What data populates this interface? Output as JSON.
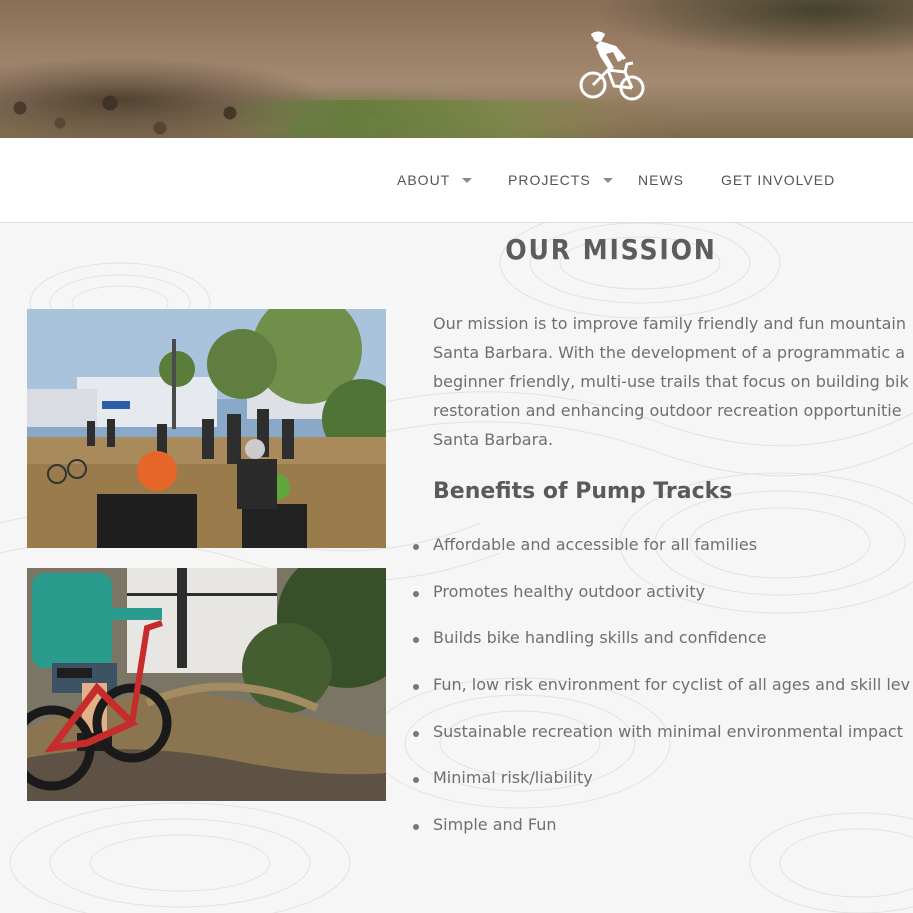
{
  "hero": {
    "logo_icon": "mountain-biker-icon"
  },
  "nav": {
    "items": [
      {
        "label": "ABOUT",
        "has_dropdown": true
      },
      {
        "label": "PROJECTS",
        "has_dropdown": true
      },
      {
        "label": "NEWS",
        "has_dropdown": false
      },
      {
        "label": "GET INVOLVED",
        "has_dropdown": false
      }
    ]
  },
  "mission": {
    "title": "OUR MISSION",
    "paragraph_lines": [
      "Our mission is to improve family friendly and fun mountain",
      "Santa Barbara.  With the development of a programmatic a",
      "beginner friendly, multi-use trails that focus on building bik",
      "restoration and enhancing outdoor recreation opportunitie",
      "Santa Barbara."
    ],
    "benefits_heading": "Benefits of Pump Tracks",
    "benefits": [
      "Affordable and accessible for all families",
      "Promotes healthy outdoor activity",
      "Builds bike handling skills and confidence",
      "Fun, low risk environment for cyclist of all ages and skill lev",
      "Sustainable recreation with minimal environmental impact",
      "Minimal risk/liability",
      "Simple and Fun"
    ]
  },
  "colors": {
    "text": "#6f6f6f",
    "heading": "#5a5a5a",
    "nav_text": "#555555",
    "background": "#f6f6f6"
  }
}
